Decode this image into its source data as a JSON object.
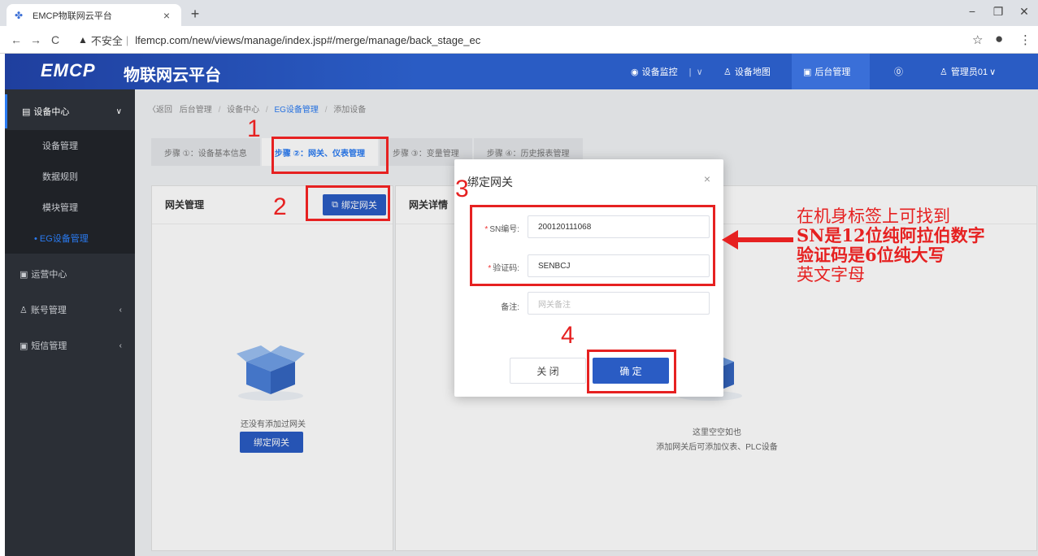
{
  "browser": {
    "tab_title": "EMCP物联网云平台",
    "tab_close": "×",
    "new_tab": "+",
    "insecure_label": "不安全",
    "url": "lfemcp.com/new/views/manage/index.jsp#/merge/manage/back_stage_ec"
  },
  "header": {
    "logo": "EMCP",
    "logo_cn": "物联网云平台",
    "device_monitor": "设备监控",
    "device_map": "设备地图",
    "backend": "后台管理",
    "user": "管理员01"
  },
  "sidebar": {
    "device_center": "设备中心",
    "sub_items": [
      "设备管理",
      "数据规则",
      "模块管理",
      "• EG设备管理"
    ],
    "ops_center": "运营中心",
    "account_mgmt": "账号管理",
    "sms_mgmt": "短信管理"
  },
  "breadcrumb": {
    "back": "〈返回",
    "items": [
      "后台管理",
      "设备中心",
      "EG设备管理",
      "添加设备"
    ]
  },
  "steps": [
    "步骤 ①：设备基本信息",
    "步骤 ②：网关、仪表管理",
    "步骤 ③：变量管理",
    "步骤 ④：历史报表管理"
  ],
  "left_panel": {
    "title": "网关管理",
    "bind_button": "绑定网关",
    "empty_text": "还没有添加过网关",
    "bind_button2": "绑定网关"
  },
  "right_panel": {
    "title": "网关详情",
    "empty_line1": "这里空空如也",
    "empty_line2": "添加网关后可添加仪表、PLC设备"
  },
  "modal": {
    "title": "绑定网关",
    "close": "×",
    "sn_label": "SN编号:",
    "sn_value": "200120111068",
    "code_label": "验证码:",
    "code_value": "SENBCJ",
    "note_label": "备注:",
    "note_placeholder": "网关备注",
    "btn_close": "关 闭",
    "btn_ok": "确 定"
  },
  "annotations": {
    "n1": "1",
    "n2": "2",
    "n3": "3",
    "n4": "4",
    "line1": "在机身标签上可找到",
    "line2": "SN是12位纯阿拉伯数字",
    "line3": "验证码是6位纯大写",
    "line4": "英文字母"
  },
  "colors": {
    "brand_blue": "#2a5cc4",
    "annotation_red": "#e62121",
    "sidebar_dark": "#2b2f36"
  }
}
